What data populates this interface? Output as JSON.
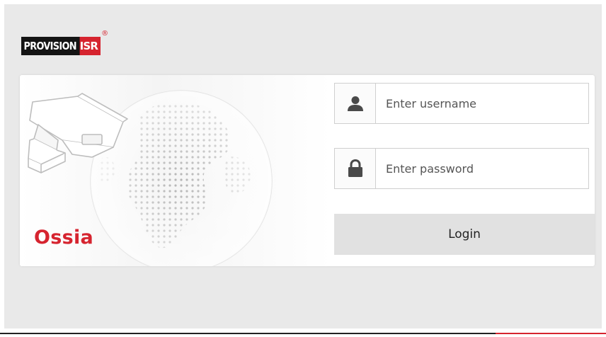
{
  "app": {
    "logo_text": "PROVISION",
    "logo_badge": "ISR",
    "logo_mark": "®",
    "product_name": "Ossia"
  },
  "login": {
    "username_placeholder": "Enter username",
    "password_placeholder": "Enter password",
    "login_label": "Login"
  },
  "icons": {
    "user": "user-icon",
    "lock": "lock-icon",
    "camera": "security-camera-illustration",
    "globe": "dotted-globe-illustration"
  },
  "colors": {
    "brand_red": "#d6242f",
    "logo_black": "#141414",
    "background": "#e9e9e9",
    "button_bg": "#e1e1e1"
  }
}
